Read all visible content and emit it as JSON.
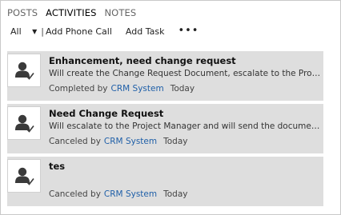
{
  "tabs": [
    {
      "label": "POSTS",
      "active": false
    },
    {
      "label": "ACTIVITIES",
      "active": true
    },
    {
      "label": "NOTES",
      "active": false
    }
  ],
  "toolbar": {
    "filter_value": "All",
    "separator": "|",
    "add_phone_call_label": "Add Phone Call",
    "add_task_label": "Add Task",
    "more_label": "•••"
  },
  "activities": [
    {
      "title": "Enhancement, need change request",
      "description": "Will create the Change Request Document, escalate to the Project Manager and will send the document to the customer",
      "status": "Completed by",
      "user": "CRM System",
      "time": "Today"
    },
    {
      "title": "Need Change Request",
      "description": "Will escalate to the Project Manager and will send the document to the customer",
      "status": "Canceled by",
      "user": "CRM System",
      "time": "Today"
    },
    {
      "title": "tes",
      "description": "",
      "status": "Canceled by",
      "user": "CRM System",
      "time": "Today"
    }
  ],
  "icons": {
    "activity_icon": "user-check-icon"
  },
  "colors": {
    "link": "#1f5fa8",
    "card_background": "#dedede"
  }
}
